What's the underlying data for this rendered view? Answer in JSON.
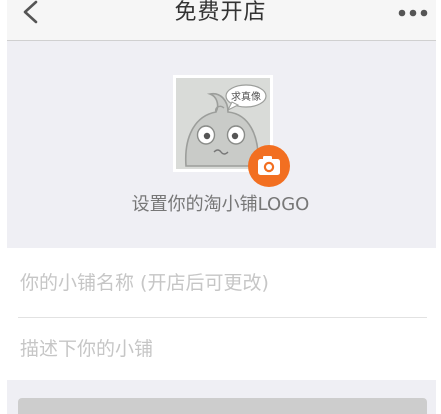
{
  "nav": {
    "title": "免费开店",
    "back_icon": "chevron-left-icon",
    "more_icon": "more-dots-icon"
  },
  "logo": {
    "bubble_text": "求真像",
    "label": "设置你的淘小铺LOGO",
    "camera_icon": "camera-icon",
    "camera_color": "#f26f21"
  },
  "form": {
    "name_placeholder": "你的小铺名称 (开店后可更改)",
    "name_value": "",
    "desc_placeholder": "描述下你的小铺",
    "desc_value": ""
  },
  "colors": {
    "background": "#efeff4",
    "accent": "#f26f21"
  }
}
